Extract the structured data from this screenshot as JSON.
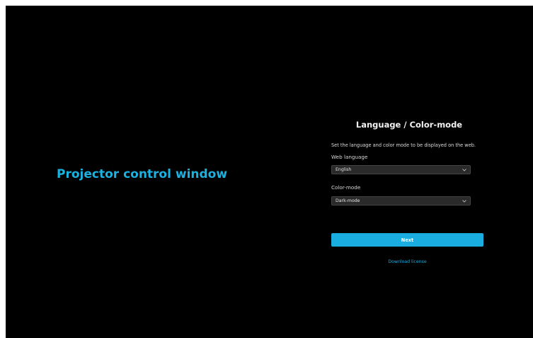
{
  "screen": {
    "caption": "Projector control window"
  },
  "panel": {
    "title": "Language / Color-mode",
    "description": "Set the language and color mode to be displayed on the web.",
    "language_label": "Web language",
    "language_value": "English",
    "colormode_label": "Color-mode",
    "colormode_value": "Dark-mode",
    "next_label": "Next",
    "license_link": "Download license"
  },
  "colors": {
    "accent": "#1aaee0",
    "background": "#000000"
  }
}
